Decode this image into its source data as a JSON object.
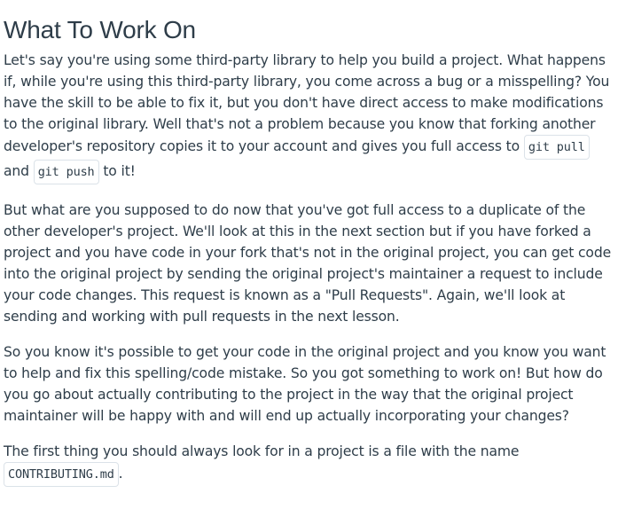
{
  "heading": "What To Work On",
  "paragraphs": [
    {
      "part1": "Let's say you're using some third-party library to help you build a project. What happens if, while you're using this third-party library, you come across a bug or a misspelling? You have the skill to be able to fix it, but you don't have direct access to make modifications to the original library. Well that's not a problem because you know that forking another developer's repository copies it to your account and gives you full access to",
      "code1": "git pull",
      "part2": "and",
      "code2": "git push",
      "part3": "to it!"
    },
    {
      "text": "But what are you supposed to do now that you've got full access to a duplicate of the other developer's project. We'll look at this in the next section but if you have forked a project and you have code in your fork that's not in the original project, you can get code into the original project by sending the original project's maintainer a request to include your code changes. This request is known as a \"Pull Requests\". Again, we'll look at sending and working with pull requests in the next lesson."
    },
    {
      "text": "So you know it's possible to get your code in the original project and you know you want to help and fix this spelling/code mistake. So you got something to work on! But how do you go about actually contributing to the project in the way that the original project maintainer will be happy with and will end up actually incorporating your changes?"
    },
    {
      "text": "The first thing you should always look for in a project is a file with the name",
      "code": "CONTRIBUTING.md",
      "after": "."
    }
  ]
}
